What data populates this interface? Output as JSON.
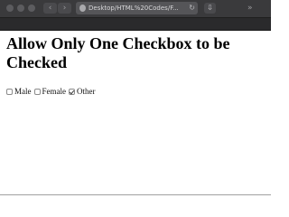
{
  "browser": {
    "url": "Desktop/HTML%20Codes/F...",
    "nav_back_glyph": "‹",
    "nav_forward_glyph": "›",
    "reload_glyph": "↻",
    "download_glyph": "⇩",
    "more_glyph": "»",
    "icons": [
      "back-icon",
      "forward-icon",
      "lock-icon",
      "reload-icon",
      "download-icon",
      "more-icon"
    ]
  },
  "page": {
    "heading": "Allow Only One Checkbox to be Checked",
    "options": [
      {
        "label": "Male",
        "checked": false
      },
      {
        "label": "Female",
        "checked": false
      },
      {
        "label": "Other",
        "checked": true
      }
    ]
  }
}
